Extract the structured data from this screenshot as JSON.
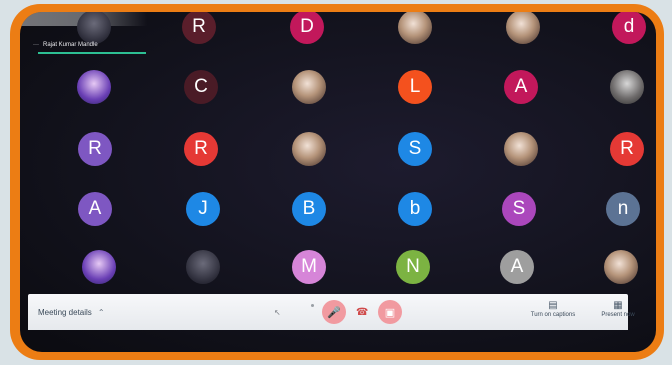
{
  "participants": {
    "name_plate": "Rajat Kumar Mandle",
    "more_icon": "more-icon",
    "initial_tiles": [
      {
        "label": "R",
        "color": "#5a1e2b"
      },
      {
        "label": "D",
        "color": "#c2185b"
      },
      {
        "label": "d",
        "color": "#c2185b"
      },
      {
        "label": "C",
        "color": "#4a1b26"
      },
      {
        "label": "L",
        "color": "#f4511e"
      },
      {
        "label": "A",
        "color": "#c2185b"
      },
      {
        "label": "R",
        "color": "#7e57c2"
      },
      {
        "label": "R",
        "color": "#e53935"
      },
      {
        "label": "S",
        "color": "#1e88e5"
      },
      {
        "label": "R",
        "color": "#e53935"
      },
      {
        "label": "A",
        "color": "#7e57c2"
      },
      {
        "label": "J",
        "color": "#1e88e5"
      },
      {
        "label": "B",
        "color": "#1e88e5"
      },
      {
        "label": "b",
        "color": "#1e88e5"
      },
      {
        "label": "S",
        "color": "#ab47bc"
      },
      {
        "label": "n",
        "color": "#5c7394"
      },
      {
        "label": "M",
        "color": "#d685d8"
      },
      {
        "label": "N",
        "color": "#7cb342"
      },
      {
        "label": "A",
        "color": "#9e9e9e"
      }
    ]
  },
  "toolbar": {
    "meeting_details_label": "Meeting details",
    "chevron_icon": "chevron-up-icon",
    "mic_icon": "mic-off-icon",
    "hangup_icon": "phone-hangup-icon",
    "camera_icon": "camera-off-icon",
    "captions_label": "Turn on captions",
    "captions_icon": "captions-icon",
    "present_label": "Present now",
    "present_icon": "present-screen-icon"
  }
}
